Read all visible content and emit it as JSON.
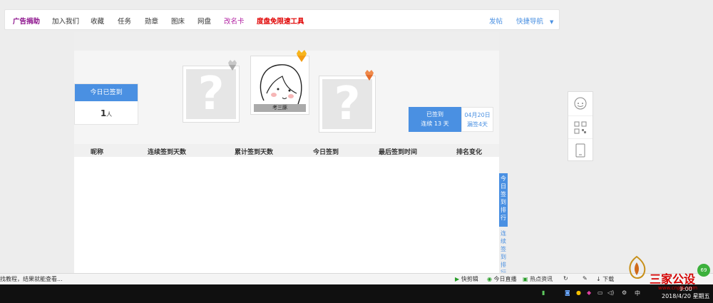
{
  "nav": {
    "items": [
      {
        "label": "广告捐助",
        "color": "#8b0f8b",
        "bold": true
      },
      {
        "label": "加入我们",
        "color": "#333333"
      },
      {
        "label": "收藏",
        "color": "#333333"
      },
      {
        "label": "任务",
        "color": "#333333"
      },
      {
        "label": "勋章",
        "color": "#333333"
      },
      {
        "label": "图床",
        "color": "#333333"
      },
      {
        "label": "网盘",
        "color": "#333333"
      },
      {
        "label": "改名卡",
        "color": "#b01ea0"
      },
      {
        "label": "度盘免限速工具",
        "color": "#e00000",
        "bold": true
      }
    ],
    "right": {
      "post": "发帖",
      "quick_nav": "快捷导航"
    }
  },
  "today": {
    "title": "今日已签到",
    "count": "1",
    "unit": "人"
  },
  "podium": {
    "first_name": "考三豚"
  },
  "sign": {
    "line1": "已签到",
    "line2": "连续 13 天"
  },
  "date_box": {
    "line1": "04月20日",
    "line2": "漏签4天"
  },
  "table": {
    "headers": [
      "昵称",
      "连续签到天数",
      "累计签到天数",
      "今日签到",
      "最后签到时间",
      "排名变化"
    ]
  },
  "rank_tabs": {
    "active": "今日签到排行",
    "inactive": "连续签到排行"
  },
  "statusbar": {
    "left": "找教程，结果就能查看...",
    "items": [
      "快剪辑",
      "今日直播",
      "热点资讯",
      "下载"
    ]
  },
  "taskbar": {
    "ime": "中",
    "time": "9:00",
    "date": "2018/4/20 星期五"
  },
  "watermark": {
    "text": "三家公设",
    "url": "www.cnpjb.com",
    "badge": "69"
  },
  "colors": {
    "accent": "#4a90e2",
    "bg": "#ededed",
    "taskbar": "#101010"
  }
}
